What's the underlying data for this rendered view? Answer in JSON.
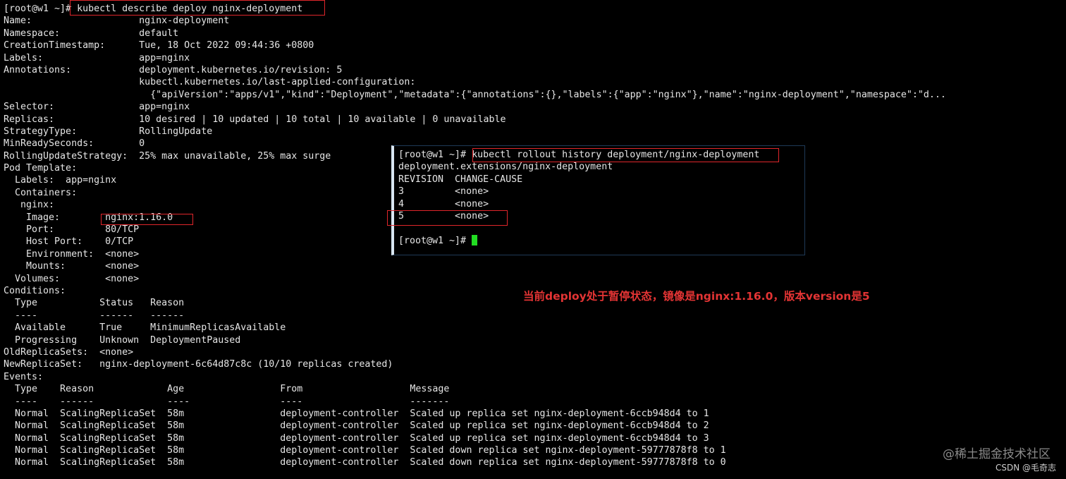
{
  "main_terminal": {
    "lines": [
      "[root@w1 ~]# kubectl describe deploy nginx-deployment",
      "Name:                   nginx-deployment",
      "Namespace:              default",
      "CreationTimestamp:      Tue, 18 Oct 2022 09:44:36 +0800",
      "Labels:                 app=nginx",
      "Annotations:            deployment.kubernetes.io/revision: 5",
      "                        kubectl.kubernetes.io/last-applied-configuration:",
      "                          {\"apiVersion\":\"apps/v1\",\"kind\":\"Deployment\",\"metadata\":{\"annotations\":{},\"labels\":{\"app\":\"nginx\"},\"name\":\"nginx-deployment\",\"namespace\":\"d...",
      "Selector:               app=nginx",
      "Replicas:               10 desired | 10 updated | 10 total | 10 available | 0 unavailable",
      "StrategyType:           RollingUpdate",
      "MinReadySeconds:        0",
      "RollingUpdateStrategy:  25% max unavailable, 25% max surge",
      "Pod Template:",
      "  Labels:  app=nginx",
      "  Containers:",
      "   nginx:",
      "    Image:        nginx:1.16.0",
      "    Port:         80/TCP",
      "    Host Port:    0/TCP",
      "    Environment:  <none>",
      "    Mounts:       <none>",
      "  Volumes:        <none>",
      "Conditions:",
      "  Type           Status   Reason",
      "  ----           ------   ------",
      "  Available      True     MinimumReplicasAvailable",
      "  Progressing    Unknown  DeploymentPaused",
      "OldReplicaSets:  <none>",
      "NewReplicaSet:   nginx-deployment-6c64d87c8c (10/10 replicas created)",
      "Events:",
      "  Type    Reason             Age                 From                   Message",
      "  ----    ------             ----                ----                   -------",
      "  Normal  ScalingReplicaSet  58m                 deployment-controller  Scaled up replica set nginx-deployment-6ccb948d4 to 1",
      "  Normal  ScalingReplicaSet  58m                 deployment-controller  Scaled up replica set nginx-deployment-6ccb948d4 to 2",
      "  Normal  ScalingReplicaSet  58m                 deployment-controller  Scaled up replica set nginx-deployment-6ccb948d4 to 3",
      "  Normal  ScalingReplicaSet  58m                 deployment-controller  Scaled down replica set nginx-deployment-59777878f8 to 1",
      "  Normal  ScalingReplicaSet  58m                 deployment-controller  Scaled down replica set nginx-deployment-59777878f8 to 0"
    ]
  },
  "popup_terminal": {
    "lines": [
      "[root@w1 ~]# kubectl rollout history deployment/nginx-deployment",
      "deployment.extensions/nginx-deployment",
      "REVISION  CHANGE-CAUSE",
      "3         <none>",
      "4         <none>",
      "5         <none>",
      "",
      "[root@w1 ~]# "
    ]
  },
  "annotation_note": "当前deploy处于暂停状态，镜像是nginx:1.16.0，版本version是5",
  "watermark": {
    "site": "@稀土掘金技术社区",
    "author": "CSDN @毛奇志"
  },
  "colors": {
    "background": "#000000",
    "text": "#e6e6e6",
    "highlight_box": "#e0262b",
    "note": "#e33434",
    "cursor": "#22dd22"
  }
}
